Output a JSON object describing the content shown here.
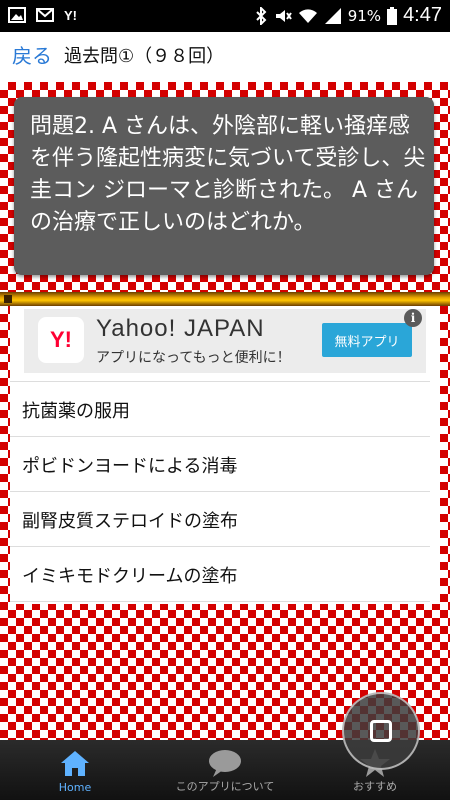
{
  "statusbar": {
    "battery": "91%",
    "time": "4:47"
  },
  "navbar": {
    "back_label": "戻る",
    "title": "過去問①（９８回）"
  },
  "question": {
    "text": "問題2. A さんは、外陰部に軽い掻痒感を伴う隆起性病変に気づいて受診し、尖圭コン ジローマと診断された。 A さんの治療で正しいのはどれか。"
  },
  "ad": {
    "logo": "Y!",
    "title": "Yahoo! JAPAN",
    "subtitle": "アプリになってもっと便利に！",
    "button": "無料アプリ",
    "info": "i"
  },
  "answers": [
    "抗菌薬の服用",
    "ポビドンヨードによる消毒",
    "副腎皮質ステロイドの塗布",
    "イミキモドクリームの塗布"
  ],
  "tabs": [
    {
      "label": "Home",
      "icon": "home-icon"
    },
    {
      "label": "このアプリについて",
      "icon": "speech-bubble-icon"
    },
    {
      "label": "おすすめ",
      "icon": "star-icon"
    }
  ],
  "colors": {
    "accent": "#2a7ad6",
    "checker": "#d40000",
    "question_bg": "#5c5c5c",
    "active_tab": "#5fb2ff"
  }
}
